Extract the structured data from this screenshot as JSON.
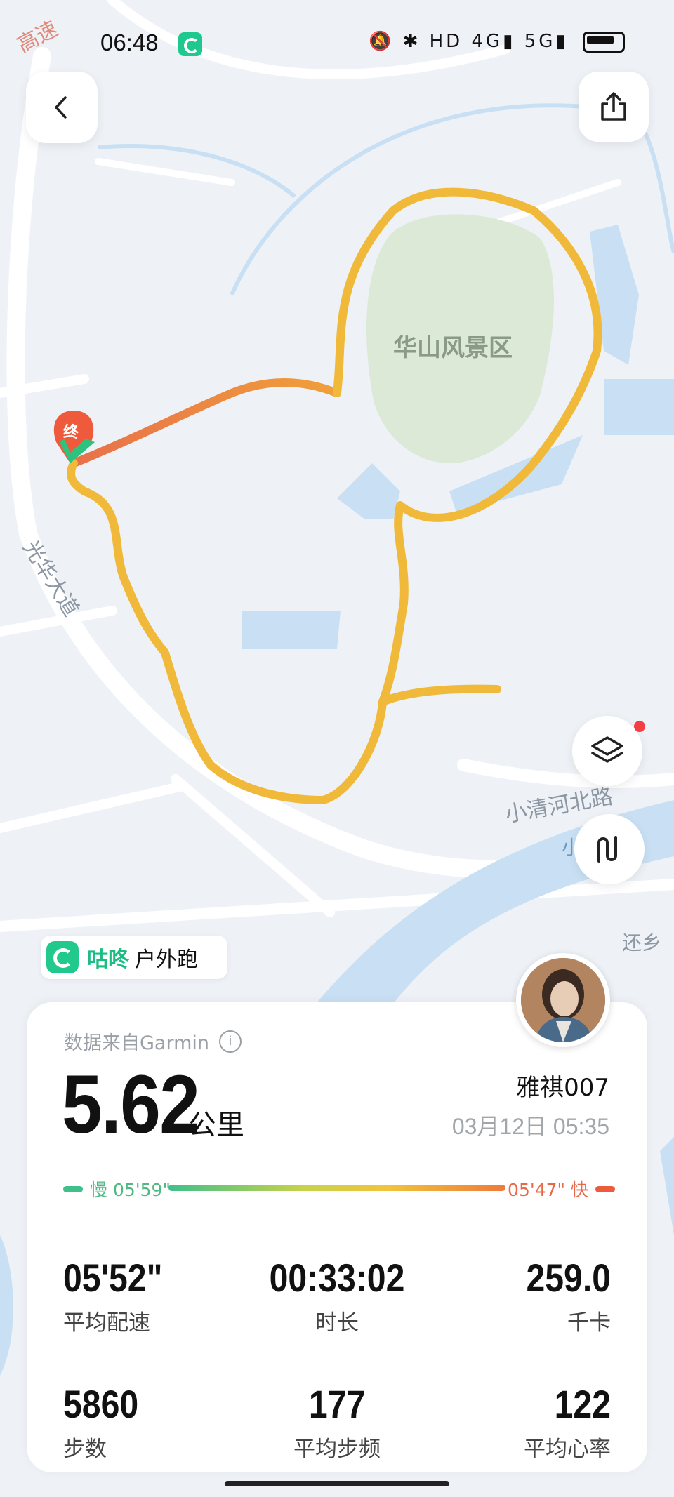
{
  "status_bar": {
    "time": "06:48",
    "icons_text": "🔕 ✱ HD 4G▮ 5G▮"
  },
  "map": {
    "labels": {
      "park": "华山风景区",
      "road_guanghua": "光华大道",
      "road_xiaoqinghe": "小清河北路",
      "road_corner": "高速",
      "place_right": "还乡",
      "small_mark": "小"
    },
    "start_end_marker": "终"
  },
  "brand": {
    "name": "咕咚",
    "sport": "户外跑"
  },
  "summary": {
    "source": "数据来自Garmin",
    "distance": "5.62",
    "distance_unit": "公里",
    "user_name": "雅祺007",
    "datetime": "03月12日 05:35",
    "pace_slow_label": "慢 05'59\"",
    "pace_fast_label": "05'47\" 快"
  },
  "stats": [
    {
      "value": "05'52\"",
      "label": "平均配速"
    },
    {
      "value": "00:33:02",
      "label": "时长"
    },
    {
      "value": "259.0",
      "label": "千卡"
    },
    {
      "value": "5860",
      "label": "步数"
    },
    {
      "value": "177",
      "label": "平均步频"
    },
    {
      "value": "122",
      "label": "平均心率"
    }
  ],
  "colors": {
    "route": "#f0b93a",
    "route_end": "#e8704a",
    "brand_green": "#21c98d",
    "park_green": "#dbe9d6",
    "water": "#c9e0f4"
  }
}
